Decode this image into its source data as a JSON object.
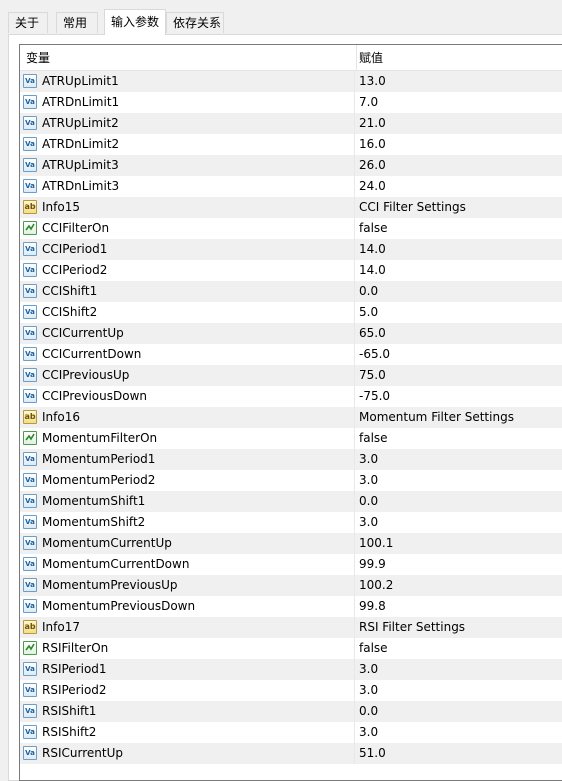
{
  "tabs": [
    {
      "label": "关于"
    },
    {
      "label": "常用"
    },
    {
      "label": "输入参数"
    },
    {
      "label": "依存关系"
    }
  ],
  "table": {
    "columns": [
      "变量",
      "赋值"
    ],
    "rows": [
      {
        "name": "ATRUpLimit1",
        "value": "13.0",
        "type": "number-icon"
      },
      {
        "name": "ATRDnLimit1",
        "value": "7.0",
        "type": "number-icon"
      },
      {
        "name": "ATRUpLimit2",
        "value": "21.0",
        "type": "number-icon"
      },
      {
        "name": "ATRDnLimit2",
        "value": "16.0",
        "type": "number-icon"
      },
      {
        "name": "ATRUpLimit3",
        "value": "26.0",
        "type": "number-icon"
      },
      {
        "name": "ATRDnLimit3",
        "value": "24.0",
        "type": "number-icon"
      },
      {
        "name": "Info15",
        "value": "CCI Filter Settings",
        "type": "string-icon"
      },
      {
        "name": "CCIFilterOn",
        "value": "false",
        "type": "bool-icon"
      },
      {
        "name": "CCIPeriod1",
        "value": "14.0",
        "type": "number-icon"
      },
      {
        "name": "CCIPeriod2",
        "value": "14.0",
        "type": "number-icon"
      },
      {
        "name": "CCIShift1",
        "value": "0.0",
        "type": "number-icon"
      },
      {
        "name": "CCIShift2",
        "value": "5.0",
        "type": "number-icon"
      },
      {
        "name": "CCICurrentUp",
        "value": "65.0",
        "type": "number-icon"
      },
      {
        "name": "CCICurrentDown",
        "value": "-65.0",
        "type": "number-icon"
      },
      {
        "name": "CCIPreviousUp",
        "value": "75.0",
        "type": "number-icon"
      },
      {
        "name": "CCIPreviousDown",
        "value": "-75.0",
        "type": "number-icon"
      },
      {
        "name": "Info16",
        "value": "Momentum Filter Settings",
        "type": "string-icon"
      },
      {
        "name": "MomentumFilterOn",
        "value": "false",
        "type": "bool-icon"
      },
      {
        "name": "MomentumPeriod1",
        "value": "3.0",
        "type": "number-icon"
      },
      {
        "name": "MomentumPeriod2",
        "value": "3.0",
        "type": "number-icon"
      },
      {
        "name": "MomentumShift1",
        "value": "0.0",
        "type": "number-icon"
      },
      {
        "name": "MomentumShift2",
        "value": "3.0",
        "type": "number-icon"
      },
      {
        "name": "MomentumCurrentUp",
        "value": "100.1",
        "type": "number-icon"
      },
      {
        "name": "MomentumCurrentDown",
        "value": "99.9",
        "type": "number-icon"
      },
      {
        "name": "MomentumPreviousUp",
        "value": "100.2",
        "type": "number-icon"
      },
      {
        "name": "MomentumPreviousDown",
        "value": "99.8",
        "type": "number-icon"
      },
      {
        "name": "Info17",
        "value": "RSI Filter Settings",
        "type": "string-icon"
      },
      {
        "name": "RSIFilterOn",
        "value": "false",
        "type": "bool-icon"
      },
      {
        "name": "RSIPeriod1",
        "value": "3.0",
        "type": "number-icon"
      },
      {
        "name": "RSIPeriod2",
        "value": "3.0",
        "type": "number-icon"
      },
      {
        "name": "RSIShift1",
        "value": "0.0",
        "type": "number-icon"
      },
      {
        "name": "RSIShift2",
        "value": "3.0",
        "type": "number-icon"
      },
      {
        "name": "RSICurrentUp",
        "value": "51.0",
        "type": "number-icon"
      }
    ]
  },
  "colors": {
    "row_shade": "#f0f0f0",
    "row_plain": "#ffffff",
    "window_bg": "#f0f0f0"
  }
}
